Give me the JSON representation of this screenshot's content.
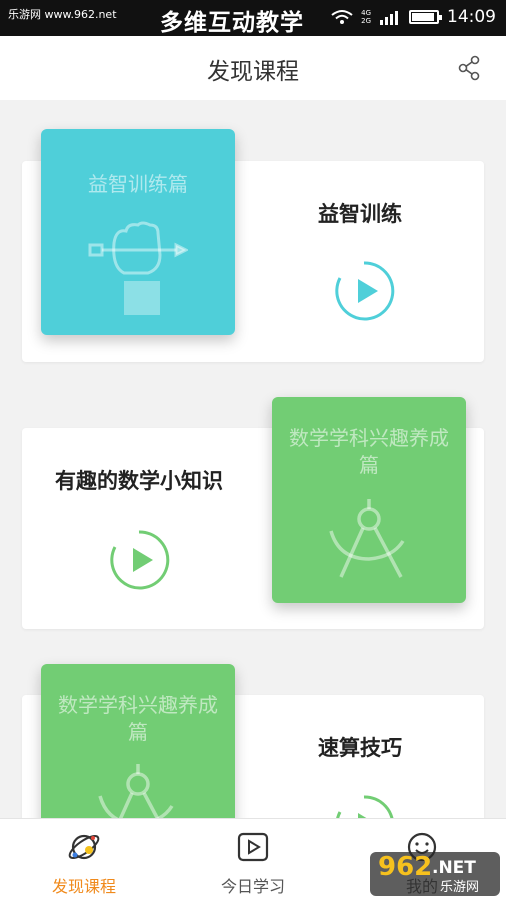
{
  "status_bar": {
    "site_text": "乐游网 www.962.net",
    "app_banner": "多维互动教学",
    "network_label_top": "4G",
    "network_label_bottom": "2G",
    "time": "14:09"
  },
  "header": {
    "title": "发现课程"
  },
  "cards": [
    {
      "tile_text": "益智训练篇",
      "title": "益智训练",
      "tile_color": "#4fcfd9",
      "accent": "#4fcfd9"
    },
    {
      "tile_text": "数学学科兴趣养成篇",
      "title": "有趣的数学小知识",
      "tile_color": "#72cd74",
      "accent": "#72cd74"
    },
    {
      "tile_text": "数学学科兴趣养成篇",
      "title": "速算技巧",
      "tile_color": "#72cd74",
      "accent": "#72cd74"
    }
  ],
  "bottom_nav": {
    "items": [
      {
        "label": "发现课程",
        "icon": "planet-icon",
        "active": true
      },
      {
        "label": "今日学习",
        "icon": "play-square-icon",
        "active": false
      },
      {
        "label": "我的",
        "icon": "smiley-icon",
        "active": false
      }
    ]
  },
  "watermark": {
    "brand_number": "962",
    "brand_suffix": ".NET",
    "brand_text": "乐游网"
  },
  "colors": {
    "active_tab": "#f08a1c",
    "teal": "#4fcfd9",
    "green": "#72cd74"
  }
}
